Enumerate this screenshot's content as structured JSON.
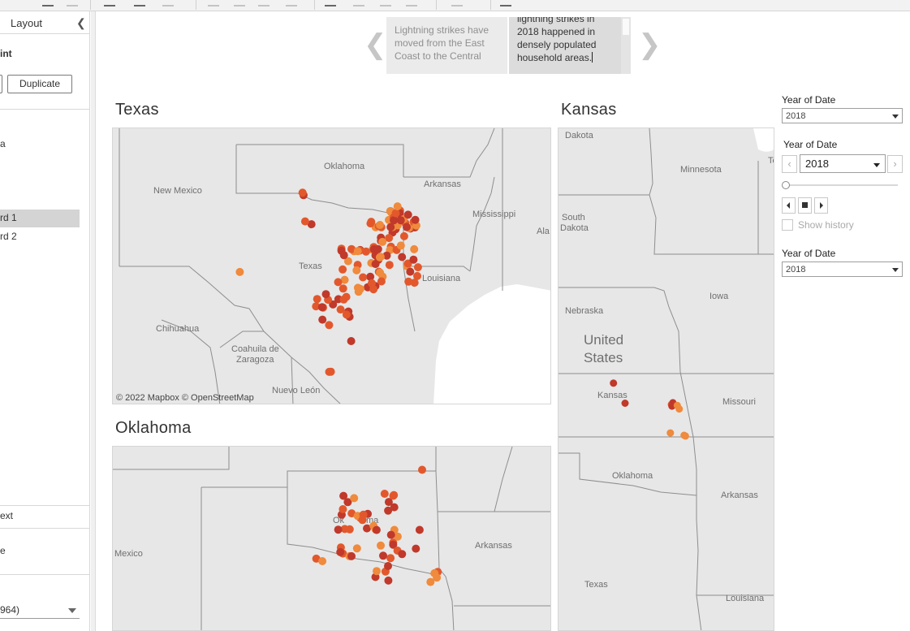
{
  "app": {
    "left_panel": {
      "tab_label": "Layout",
      "section_fragment": "int",
      "duplicate_label": "Duplicate",
      "item_fragment_a": "a",
      "items": [
        "rd 1",
        "rd 2"
      ],
      "text_fragment": "ext",
      "e_fragment": "e",
      "select_value": "964)"
    },
    "story": {
      "point1_text": "Lightning strikes have moved from the East Coast to the Central",
      "point2_lines": [
        "lightning strikes in",
        "2018 happened in",
        "densely populated",
        "household areas."
      ]
    },
    "sheets": {
      "texas": {
        "title": "Texas",
        "attribution": "© 2022 Mapbox  © OpenStreetMap",
        "labels": [
          "New Mexico",
          "Oklahoma",
          "Arkansas",
          "Mississippi",
          "Ala",
          "Texas",
          "Louisiana",
          "Chihuahua",
          "Coahuila de",
          "Zaragoza",
          "Nuevo León"
        ]
      },
      "kansas": {
        "title": "Kansas",
        "labels": [
          "Dakota",
          "Minnesota",
          "Te",
          "South",
          "Dakota",
          "Iowa",
          "Nebraska",
          "United",
          "States",
          "Kansas",
          "Missouri",
          "Oklahoma",
          "Arkansas",
          "Texas",
          "Louisiana"
        ]
      },
      "oklahoma": {
        "title": "Oklahoma",
        "labels": [
          "Mexico",
          "Ok",
          "ma",
          "Arkansas"
        ]
      }
    },
    "filters": {
      "f1": {
        "label": "Year of Date",
        "value": "2018"
      },
      "f2": {
        "label": "Year of Date",
        "value": "2018",
        "prev_icon": "chevron-left",
        "next_icon": "chevron-right",
        "show_history": "Show history"
      },
      "f3": {
        "label": "Year of Date",
        "value": "2018"
      }
    },
    "colors": {
      "strike_dark": "#c0392b",
      "strike_mid": "#e2582c",
      "strike_light": "#f08a3c",
      "land": "#e7e7e7",
      "water": "#ffffff"
    }
  }
}
